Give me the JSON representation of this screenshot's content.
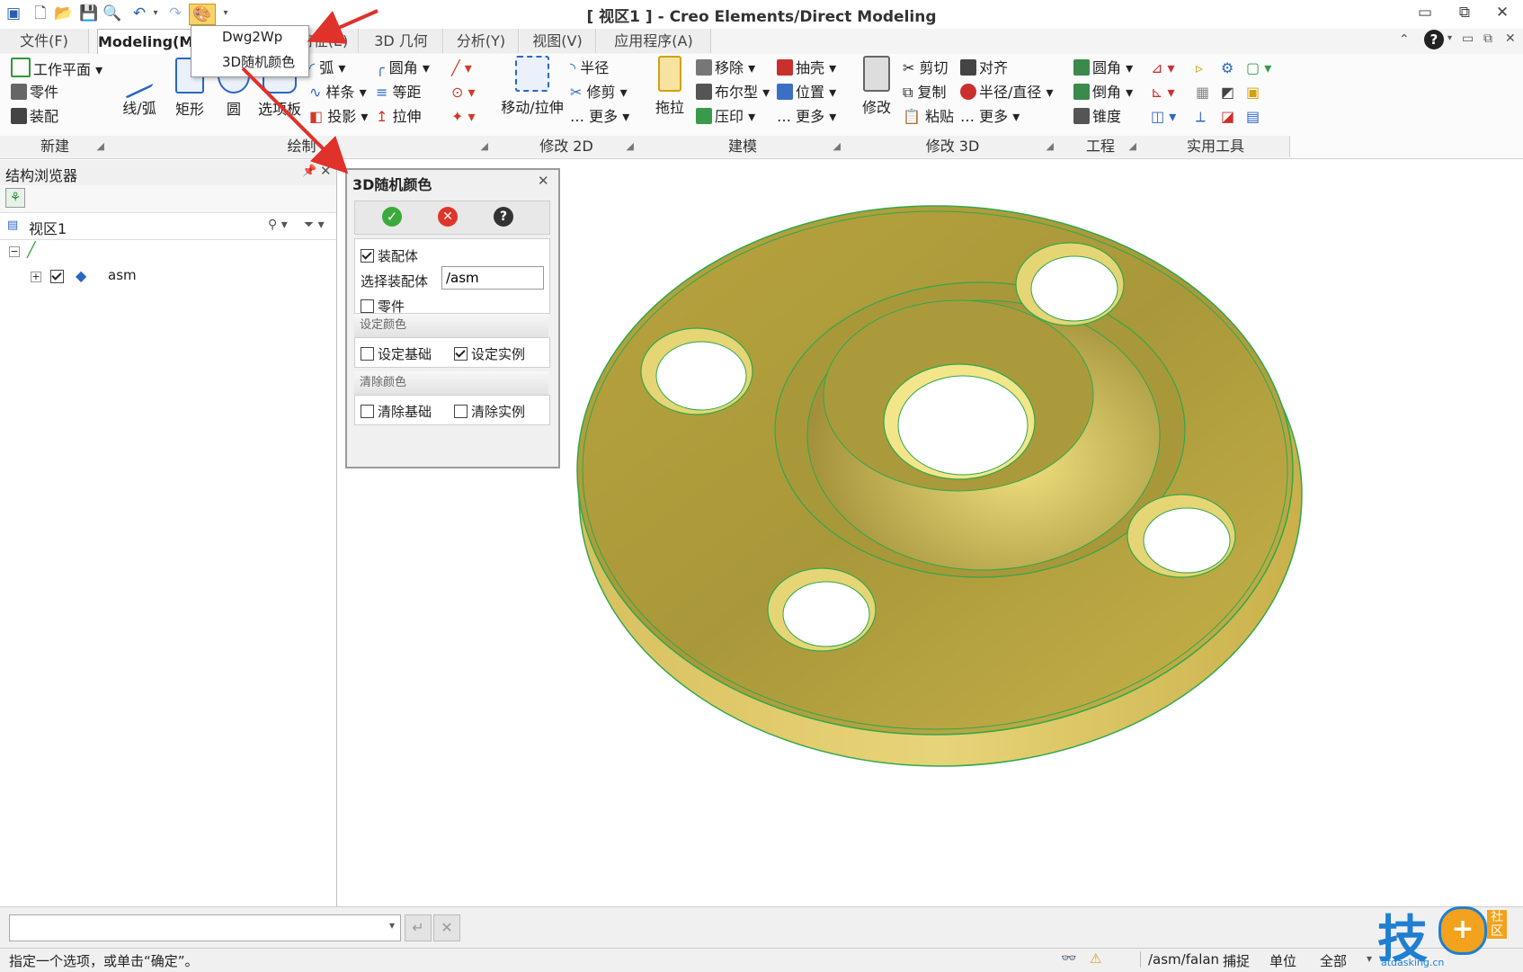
{
  "window": {
    "title": "[ 视区1 ] - Creo Elements/Direct Modeling",
    "minimize_glyph": "▭",
    "restore_glyph": "⧉",
    "close_glyph": "✕"
  },
  "tabs": [
    {
      "label": "文件(F)"
    },
    {
      "label": "Modeling(M)"
    },
    {
      "label": "特征(E)"
    },
    {
      "label": "3D 几何"
    },
    {
      "label": "分析(Y)"
    },
    {
      "label": "视图(V)"
    },
    {
      "label": "应用程序(A)"
    }
  ],
  "dropdown": {
    "items": [
      "Dwg2Wp",
      "3D随机颜色"
    ]
  },
  "ribbon": {
    "new_items": [
      "工作平面",
      "零件",
      "装配"
    ],
    "draw_big": [
      "线/弧",
      "矩形",
      "圆",
      "选项板"
    ],
    "draw_small_col1": [
      "弧",
      "样条",
      "投影"
    ],
    "draw_small_col2": [
      "圆角",
      "等距",
      "拉伸"
    ],
    "modify2d_big": "移动/拉伸",
    "modify2d_small": [
      "半径",
      "修剪",
      "更多"
    ],
    "model_big": "拖拉",
    "model_col1": [
      "移除",
      "布尔型",
      "压印"
    ],
    "model_col2": [
      "抽壳",
      "位置",
      "更多"
    ],
    "modify3d_big": "修改",
    "modify3d_col1": [
      "剪切",
      "复制",
      "粘贴"
    ],
    "modify3d_col2": [
      "对齐",
      "半径/直径",
      "更多"
    ],
    "eng_items": [
      "圆角",
      "倒角",
      "锥度"
    ],
    "groups": [
      "新建",
      "绘制",
      "修改 2D",
      "建模",
      "修改 3D",
      "工程",
      "实用工具"
    ]
  },
  "browser": {
    "title": "结构浏览器",
    "view_label": "视区1",
    "tree_node": "asm"
  },
  "dialog": {
    "title": "3D随机颜色",
    "assembly_label": "装配体",
    "select_assembly_label": "选择装配体",
    "select_assembly_value": "/asm",
    "part_label": "零件",
    "set_color_header": "设定颜色",
    "set_base_label": "设定基础",
    "set_instance_label": "设定实例",
    "clear_color_header": "清除颜色",
    "clear_base_label": "清除基础",
    "clear_instance_label": "清除实例",
    "assembly_checked": true,
    "part_checked": false,
    "set_base_checked": false,
    "set_instance_checked": true,
    "clear_base_checked": false,
    "clear_instance_checked": false
  },
  "status": {
    "message": "指定一个选项，或单击“确定”。",
    "path": "/asm/falan",
    "snap": "捕捉",
    "units": "单位",
    "all": "全部"
  },
  "watermark": {
    "char": "技",
    "badge": "社区",
    "site": "atdasking.cn"
  },
  "colors": {
    "accent": "#2b67c4",
    "part_gold": "#c9b24a",
    "edge_green": "#2fa84a",
    "ok_green": "#3aaa3a",
    "cancel_red": "#e0352b",
    "arrow_red": "#e0312a"
  }
}
